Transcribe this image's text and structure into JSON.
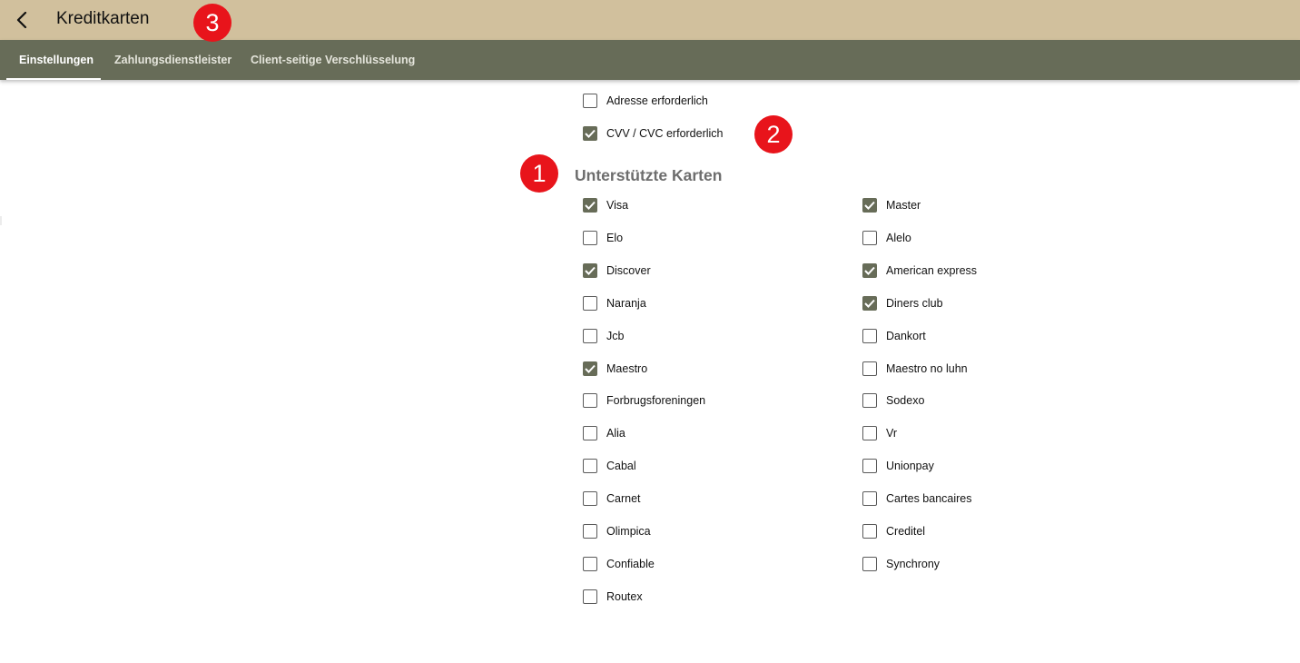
{
  "header": {
    "title": "Kreditkarten",
    "back_icon": "chevron-left-icon"
  },
  "tabs": [
    {
      "label": "Einstellungen",
      "active": true
    },
    {
      "label": "Zahlungsdienstleister",
      "active": false
    },
    {
      "label": "Client-seitige Verschlüsselung",
      "active": false
    }
  ],
  "badges": [
    "1",
    "2",
    "3"
  ],
  "options": [
    {
      "label": "Adresse erforderlich",
      "checked": false
    },
    {
      "label": "CVV / CVC erforderlich",
      "checked": true
    }
  ],
  "supported_cards": {
    "heading": "Unterstützte Karten",
    "left": [
      {
        "label": "Visa",
        "checked": true
      },
      {
        "label": "Elo",
        "checked": false
      },
      {
        "label": "Discover",
        "checked": true
      },
      {
        "label": "Naranja",
        "checked": false
      },
      {
        "label": "Jcb",
        "checked": false
      },
      {
        "label": "Maestro",
        "checked": true
      },
      {
        "label": "Forbrugsforeningen",
        "checked": false
      },
      {
        "label": "Alia",
        "checked": false
      },
      {
        "label": "Cabal",
        "checked": false
      },
      {
        "label": "Carnet",
        "checked": false
      },
      {
        "label": "Olimpica",
        "checked": false
      },
      {
        "label": "Confiable",
        "checked": false
      },
      {
        "label": "Routex",
        "checked": false
      }
    ],
    "right": [
      {
        "label": "Master",
        "checked": true
      },
      {
        "label": "Alelo",
        "checked": false
      },
      {
        "label": "American express",
        "checked": true
      },
      {
        "label": "Diners club",
        "checked": true
      },
      {
        "label": "Dankort",
        "checked": false
      },
      {
        "label": "Maestro no luhn",
        "checked": false
      },
      {
        "label": "Sodexo",
        "checked": false
      },
      {
        "label": "Vr",
        "checked": false
      },
      {
        "label": "Unionpay",
        "checked": false
      },
      {
        "label": "Cartes bancaires",
        "checked": false
      },
      {
        "label": "Creditel",
        "checked": false
      },
      {
        "label": "Synchrony",
        "checked": false
      }
    ]
  },
  "colors": {
    "appbar": "#d1c09d",
    "tabbar": "#676c58",
    "checkbox_checked": "#676c58",
    "badge": "#e8141b"
  }
}
